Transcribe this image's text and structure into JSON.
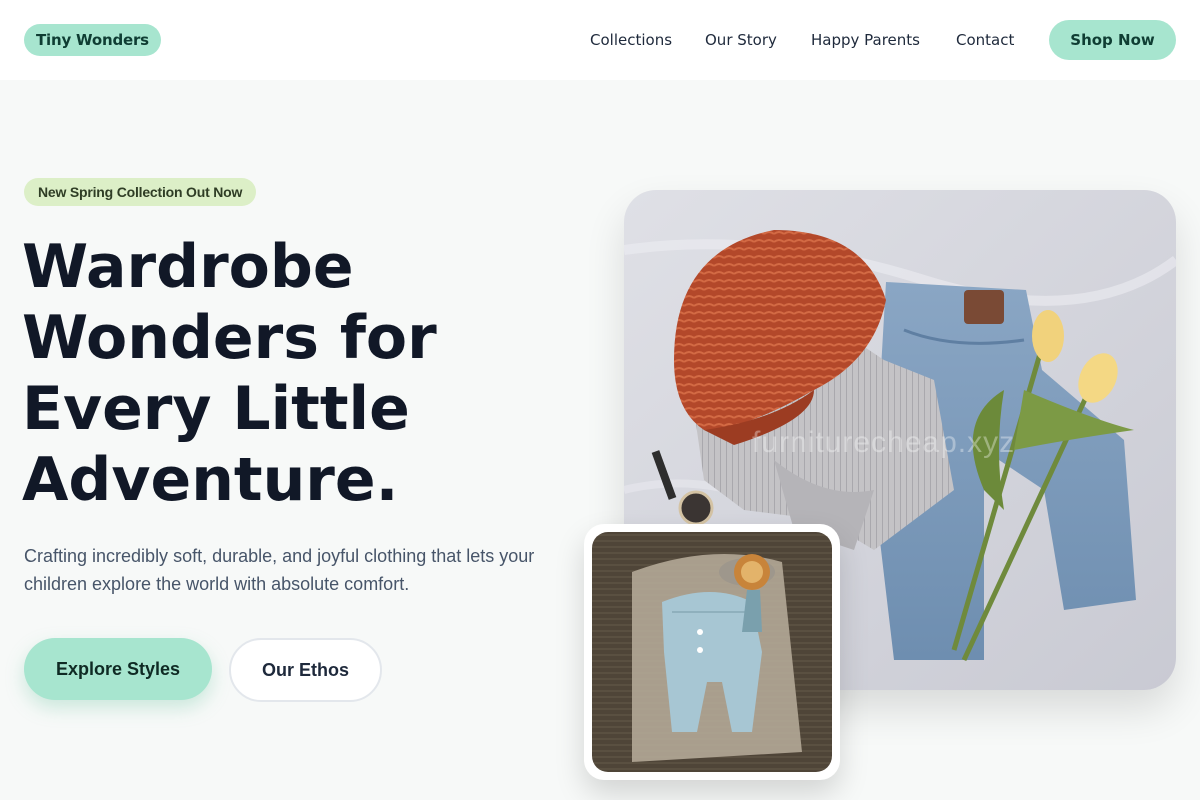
{
  "header": {
    "logo": "Tiny Wonders",
    "nav": [
      "Collections",
      "Our Story",
      "Happy Parents",
      "Contact"
    ],
    "cta": "Shop Now"
  },
  "hero": {
    "badge": "New Spring Collection Out Now",
    "headline_lines": [
      "Wardrobe",
      "Wonders for",
      "Every Little",
      "Adventure."
    ],
    "subtext": "Crafting incredibly soft, durable, and joyful clothing that lets your children explore the world with absolute comfort.",
    "primary_button": "Explore Styles",
    "secondary_button": "Our Ethos",
    "watermark": "furniturecheap.xyz"
  },
  "colors": {
    "accent": "#a7e5cf",
    "badge_bg": "#dcefc7",
    "text_dark": "#111827",
    "text_muted": "#475569",
    "page_bg": "#f7f9f8"
  }
}
